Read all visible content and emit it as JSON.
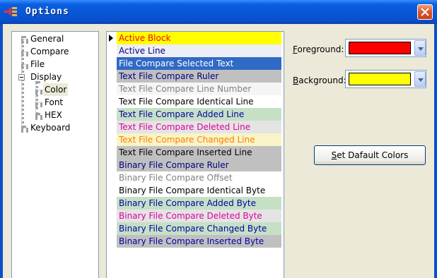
{
  "window": {
    "title": "Options"
  },
  "tree": {
    "nodes": [
      {
        "label": "General"
      },
      {
        "label": "Compare"
      },
      {
        "label": "File"
      },
      {
        "label": "Display"
      },
      {
        "label": "Color"
      },
      {
        "label": "Font"
      },
      {
        "label": "HEX"
      },
      {
        "label": "Keyboard"
      }
    ],
    "selected": "Color"
  },
  "color_list": {
    "items": [
      {
        "label": "Active Block",
        "fg": "#ff0000",
        "bg": "#ffff00"
      },
      {
        "label": "Active Line",
        "fg": "#000080",
        "bg": "#eeeef6"
      },
      {
        "label": "File Compare Selected Text",
        "fg": "#ffffff",
        "bg": "#316ac5"
      },
      {
        "label": "Text File Compare Ruler",
        "fg": "#000080",
        "bg": "#c0c0c0"
      },
      {
        "label": "Text File Compare Line Number",
        "fg": "#808080",
        "bg": "#f5f5f5"
      },
      {
        "label": "Text File Compare Identical Line",
        "fg": "#000000",
        "bg": "#ffffff"
      },
      {
        "label": "Text File Compare Added Line",
        "fg": "#0000a0",
        "bg": "#c6e0c6"
      },
      {
        "label": "Text File Compare Deleted Line",
        "fg": "#e000a0",
        "bg": "#e4e4e4"
      },
      {
        "label": "Text File Compare Changed Line",
        "fg": "#ff8000",
        "bg": "#f8f4c8"
      },
      {
        "label": "Text File Compare Inserted Line",
        "fg": "#000000",
        "bg": "#c0c0c0"
      },
      {
        "label": "Binary File Compare Ruler",
        "fg": "#000080",
        "bg": "#c0c0c0"
      },
      {
        "label": "Binary File Compare Offset",
        "fg": "#808080",
        "bg": "#ffffff"
      },
      {
        "label": "Binary File Compare Identical Byte",
        "fg": "#000000",
        "bg": "#ffffff"
      },
      {
        "label": "Binary File Compare Added Byte",
        "fg": "#0000a0",
        "bg": "#c6e0c6"
      },
      {
        "label": "Binary File Compare Deleted Byte",
        "fg": "#e000a0",
        "bg": "#e4e4e4"
      },
      {
        "label": "Binary File Compare Changed Byte",
        "fg": "#0000a0",
        "bg": "#c6e0c6"
      },
      {
        "label": "Binary File Compare Inserted Byte",
        "fg": "#0000a0",
        "bg": "#c0c0c0"
      }
    ],
    "selected_index": 0
  },
  "foreground": {
    "label_key": "F",
    "label_rest": "oreground:",
    "color": "#ff0000"
  },
  "background": {
    "label_key": "B",
    "label_rest": "ackground:",
    "color": "#ffff00"
  },
  "set_default": {
    "label_key": "S",
    "label_rest": "et Dafault Colors"
  },
  "colors": {
    "titlebar": "#0856d6",
    "dialog_bg": "#ece9d8",
    "close_button": "#e0582e"
  }
}
